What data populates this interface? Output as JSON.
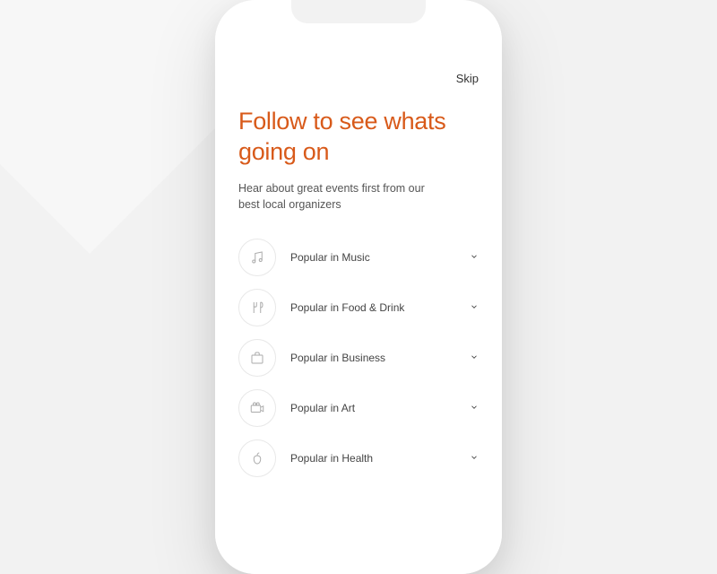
{
  "header": {
    "skip_label": "Skip"
  },
  "title": "Follow to see whats going on",
  "subtitle": "Hear about great events first from our best local organizers",
  "categories": [
    {
      "label": "Popular in Music",
      "icon": "music"
    },
    {
      "label": "Popular in Food & Drink",
      "icon": "food"
    },
    {
      "label": "Popular in Business",
      "icon": "business"
    },
    {
      "label": "Popular in Art",
      "icon": "art"
    },
    {
      "label": "Popular in Health",
      "icon": "health"
    }
  ]
}
